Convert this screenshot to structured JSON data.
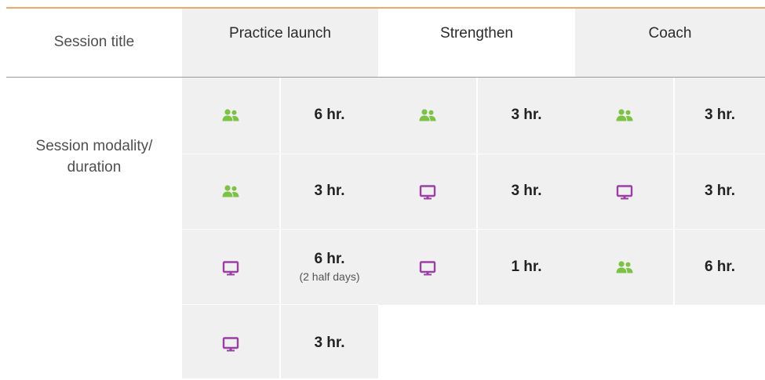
{
  "row_labels": {
    "title": "Session title",
    "modality_line1": "Session modality/",
    "modality_line2": "duration"
  },
  "columns": [
    {
      "name": "Practice launch",
      "sessions": [
        {
          "modality": "in-person",
          "icon": "people-icon",
          "duration": "6 hr.",
          "note": ""
        },
        {
          "modality": "in-person",
          "icon": "people-icon",
          "duration": "3 hr.",
          "note": ""
        },
        {
          "modality": "virtual",
          "icon": "monitor-icon",
          "duration": "6 hr.",
          "note": "(2 half days)"
        },
        {
          "modality": "virtual",
          "icon": "monitor-icon",
          "duration": "3 hr.",
          "note": ""
        }
      ]
    },
    {
      "name": "Strengthen",
      "sessions": [
        {
          "modality": "in-person",
          "icon": "people-icon",
          "duration": "3 hr.",
          "note": ""
        },
        {
          "modality": "virtual",
          "icon": "monitor-icon",
          "duration": "3 hr.",
          "note": ""
        },
        {
          "modality": "virtual",
          "icon": "monitor-icon",
          "duration": "1 hr.",
          "note": ""
        }
      ]
    },
    {
      "name": "Coach",
      "sessions": [
        {
          "modality": "in-person",
          "icon": "people-icon",
          "duration": "3 hr.",
          "note": ""
        },
        {
          "modality": "virtual",
          "icon": "monitor-icon",
          "duration": "3 hr.",
          "note": ""
        },
        {
          "modality": "in-person",
          "icon": "people-icon",
          "duration": "6 hr.",
          "note": ""
        }
      ]
    }
  ],
  "colors": {
    "accent_line": "#f0a866",
    "in_person_icon": "#7cc243",
    "virtual_icon": "#9b3fa6",
    "cell_background": "#f0f0f0"
  }
}
